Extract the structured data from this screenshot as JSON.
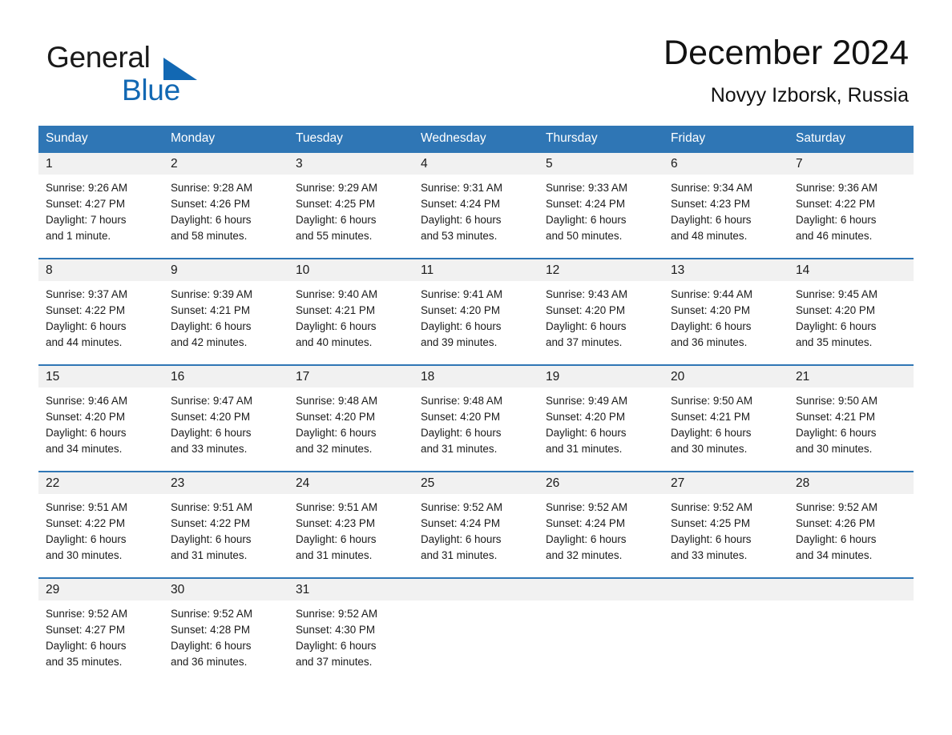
{
  "logo": {
    "line1": "General",
    "line2": "Blue",
    "triangle_color": "#1268b3"
  },
  "header": {
    "title": "December 2024",
    "subtitle": "Novyy Izborsk, Russia"
  },
  "colors": {
    "header_blue": "#2f76b5",
    "day_band_gray": "#f1f1f1",
    "text": "#1a1a1a"
  },
  "weekdays": [
    "Sunday",
    "Monday",
    "Tuesday",
    "Wednesday",
    "Thursday",
    "Friday",
    "Saturday"
  ],
  "weeks": [
    [
      {
        "day": "1",
        "sunrise": "Sunrise: 9:26 AM",
        "sunset": "Sunset: 4:27 PM",
        "daylight1": "Daylight: 7 hours",
        "daylight2": "and 1 minute."
      },
      {
        "day": "2",
        "sunrise": "Sunrise: 9:28 AM",
        "sunset": "Sunset: 4:26 PM",
        "daylight1": "Daylight: 6 hours",
        "daylight2": "and 58 minutes."
      },
      {
        "day": "3",
        "sunrise": "Sunrise: 9:29 AM",
        "sunset": "Sunset: 4:25 PM",
        "daylight1": "Daylight: 6 hours",
        "daylight2": "and 55 minutes."
      },
      {
        "day": "4",
        "sunrise": "Sunrise: 9:31 AM",
        "sunset": "Sunset: 4:24 PM",
        "daylight1": "Daylight: 6 hours",
        "daylight2": "and 53 minutes."
      },
      {
        "day": "5",
        "sunrise": "Sunrise: 9:33 AM",
        "sunset": "Sunset: 4:24 PM",
        "daylight1": "Daylight: 6 hours",
        "daylight2": "and 50 minutes."
      },
      {
        "day": "6",
        "sunrise": "Sunrise: 9:34 AM",
        "sunset": "Sunset: 4:23 PM",
        "daylight1": "Daylight: 6 hours",
        "daylight2": "and 48 minutes."
      },
      {
        "day": "7",
        "sunrise": "Sunrise: 9:36 AM",
        "sunset": "Sunset: 4:22 PM",
        "daylight1": "Daylight: 6 hours",
        "daylight2": "and 46 minutes."
      }
    ],
    [
      {
        "day": "8",
        "sunrise": "Sunrise: 9:37 AM",
        "sunset": "Sunset: 4:22 PM",
        "daylight1": "Daylight: 6 hours",
        "daylight2": "and 44 minutes."
      },
      {
        "day": "9",
        "sunrise": "Sunrise: 9:39 AM",
        "sunset": "Sunset: 4:21 PM",
        "daylight1": "Daylight: 6 hours",
        "daylight2": "and 42 minutes."
      },
      {
        "day": "10",
        "sunrise": "Sunrise: 9:40 AM",
        "sunset": "Sunset: 4:21 PM",
        "daylight1": "Daylight: 6 hours",
        "daylight2": "and 40 minutes."
      },
      {
        "day": "11",
        "sunrise": "Sunrise: 9:41 AM",
        "sunset": "Sunset: 4:20 PM",
        "daylight1": "Daylight: 6 hours",
        "daylight2": "and 39 minutes."
      },
      {
        "day": "12",
        "sunrise": "Sunrise: 9:43 AM",
        "sunset": "Sunset: 4:20 PM",
        "daylight1": "Daylight: 6 hours",
        "daylight2": "and 37 minutes."
      },
      {
        "day": "13",
        "sunrise": "Sunrise: 9:44 AM",
        "sunset": "Sunset: 4:20 PM",
        "daylight1": "Daylight: 6 hours",
        "daylight2": "and 36 minutes."
      },
      {
        "day": "14",
        "sunrise": "Sunrise: 9:45 AM",
        "sunset": "Sunset: 4:20 PM",
        "daylight1": "Daylight: 6 hours",
        "daylight2": "and 35 minutes."
      }
    ],
    [
      {
        "day": "15",
        "sunrise": "Sunrise: 9:46 AM",
        "sunset": "Sunset: 4:20 PM",
        "daylight1": "Daylight: 6 hours",
        "daylight2": "and 34 minutes."
      },
      {
        "day": "16",
        "sunrise": "Sunrise: 9:47 AM",
        "sunset": "Sunset: 4:20 PM",
        "daylight1": "Daylight: 6 hours",
        "daylight2": "and 33 minutes."
      },
      {
        "day": "17",
        "sunrise": "Sunrise: 9:48 AM",
        "sunset": "Sunset: 4:20 PM",
        "daylight1": "Daylight: 6 hours",
        "daylight2": "and 32 minutes."
      },
      {
        "day": "18",
        "sunrise": "Sunrise: 9:48 AM",
        "sunset": "Sunset: 4:20 PM",
        "daylight1": "Daylight: 6 hours",
        "daylight2": "and 31 minutes."
      },
      {
        "day": "19",
        "sunrise": "Sunrise: 9:49 AM",
        "sunset": "Sunset: 4:20 PM",
        "daylight1": "Daylight: 6 hours",
        "daylight2": "and 31 minutes."
      },
      {
        "day": "20",
        "sunrise": "Sunrise: 9:50 AM",
        "sunset": "Sunset: 4:21 PM",
        "daylight1": "Daylight: 6 hours",
        "daylight2": "and 30 minutes."
      },
      {
        "day": "21",
        "sunrise": "Sunrise: 9:50 AM",
        "sunset": "Sunset: 4:21 PM",
        "daylight1": "Daylight: 6 hours",
        "daylight2": "and 30 minutes."
      }
    ],
    [
      {
        "day": "22",
        "sunrise": "Sunrise: 9:51 AM",
        "sunset": "Sunset: 4:22 PM",
        "daylight1": "Daylight: 6 hours",
        "daylight2": "and 30 minutes."
      },
      {
        "day": "23",
        "sunrise": "Sunrise: 9:51 AM",
        "sunset": "Sunset: 4:22 PM",
        "daylight1": "Daylight: 6 hours",
        "daylight2": "and 31 minutes."
      },
      {
        "day": "24",
        "sunrise": "Sunrise: 9:51 AM",
        "sunset": "Sunset: 4:23 PM",
        "daylight1": "Daylight: 6 hours",
        "daylight2": "and 31 minutes."
      },
      {
        "day": "25",
        "sunrise": "Sunrise: 9:52 AM",
        "sunset": "Sunset: 4:24 PM",
        "daylight1": "Daylight: 6 hours",
        "daylight2": "and 31 minutes."
      },
      {
        "day": "26",
        "sunrise": "Sunrise: 9:52 AM",
        "sunset": "Sunset: 4:24 PM",
        "daylight1": "Daylight: 6 hours",
        "daylight2": "and 32 minutes."
      },
      {
        "day": "27",
        "sunrise": "Sunrise: 9:52 AM",
        "sunset": "Sunset: 4:25 PM",
        "daylight1": "Daylight: 6 hours",
        "daylight2": "and 33 minutes."
      },
      {
        "day": "28",
        "sunrise": "Sunrise: 9:52 AM",
        "sunset": "Sunset: 4:26 PM",
        "daylight1": "Daylight: 6 hours",
        "daylight2": "and 34 minutes."
      }
    ],
    [
      {
        "day": "29",
        "sunrise": "Sunrise: 9:52 AM",
        "sunset": "Sunset: 4:27 PM",
        "daylight1": "Daylight: 6 hours",
        "daylight2": "and 35 minutes."
      },
      {
        "day": "30",
        "sunrise": "Sunrise: 9:52 AM",
        "sunset": "Sunset: 4:28 PM",
        "daylight1": "Daylight: 6 hours",
        "daylight2": "and 36 minutes."
      },
      {
        "day": "31",
        "sunrise": "Sunrise: 9:52 AM",
        "sunset": "Sunset: 4:30 PM",
        "daylight1": "Daylight: 6 hours",
        "daylight2": "and 37 minutes."
      },
      {
        "day": "",
        "sunrise": "",
        "sunset": "",
        "daylight1": "",
        "daylight2": ""
      },
      {
        "day": "",
        "sunrise": "",
        "sunset": "",
        "daylight1": "",
        "daylight2": ""
      },
      {
        "day": "",
        "sunrise": "",
        "sunset": "",
        "daylight1": "",
        "daylight2": ""
      },
      {
        "day": "",
        "sunrise": "",
        "sunset": "",
        "daylight1": "",
        "daylight2": ""
      }
    ]
  ]
}
